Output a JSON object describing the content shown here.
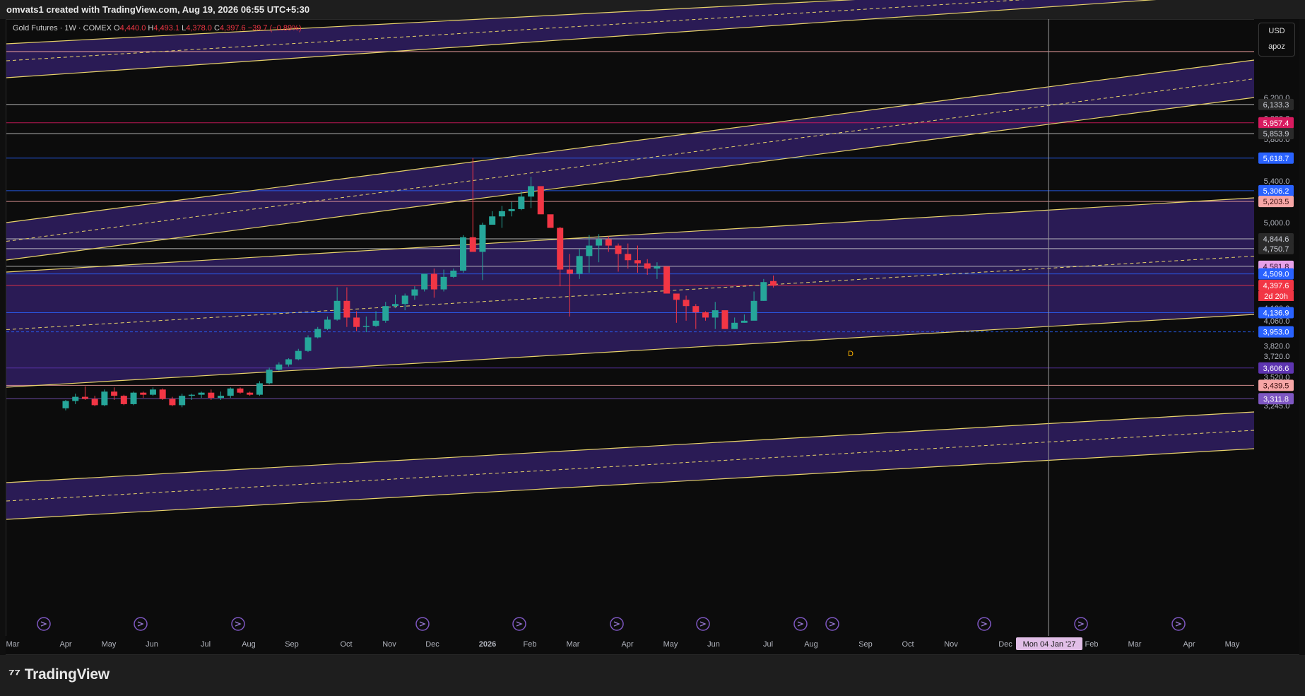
{
  "header": {
    "credit": "omvats1 created with TradingView.com, Aug 19, 2026 06:55 UTC+5:30"
  },
  "legend": {
    "symbol": "Gold Futures · 1W · COMEX",
    "o_label": "O",
    "o_value": "4,440.0",
    "h_label": "H",
    "h_value": "4,493.1",
    "l_label": "L",
    "l_value": "4,378.0",
    "c_label": "C",
    "c_value": "4,397.6",
    "change": "−39.7 (−0.89%)"
  },
  "currency": {
    "unit": "USD",
    "scale": "apoz"
  },
  "footer": {
    "brand": "TradingView"
  },
  "colors": {
    "background": "#0c0c0c",
    "channel_fill": "#2a1b55",
    "channel_line": "#e8d36b",
    "up_candle": "#26a69a",
    "down_candle": "#f23645",
    "crosshair": "#9a9a9a"
  },
  "price_axis_ticks": [
    "6,200.0",
    "6,000.0",
    "5,800.0",
    "5,400.0",
    "5,000.0",
    "4,840.0",
    "4,500.0",
    "4,300.0",
    "4,180.0",
    "4,060.0",
    "3,820.0",
    "3,720.0",
    "3,620.0",
    "3,520.0",
    "3,420.0",
    "3,320.0",
    "3,245.0"
  ],
  "price_levels": [
    {
      "value": "6,133.3",
      "bg": "#2a2a2a",
      "fg": "#d1d4dc",
      "line": "#cfcfcf"
    },
    {
      "value": "5,957.4",
      "bg": "#d81b60",
      "fg": "#ffffff",
      "line": "#d81b60"
    },
    {
      "value": "5,853.9",
      "bg": "#2a2a2a",
      "fg": "#d1d4dc",
      "line": "#cfcfcf"
    },
    {
      "value": "5,618.7",
      "bg": "#2962ff",
      "fg": "#ffffff",
      "line": "#2962ff"
    },
    {
      "value": "5,306.2",
      "bg": "#2962ff",
      "fg": "#ffffff",
      "line": "#2962ff"
    },
    {
      "value": "5,203.5",
      "bg": "#f7a6a6",
      "fg": "#3a0e0e",
      "line": "#f0a0a0"
    },
    {
      "value": "4,844.6",
      "bg": "#2a2a2a",
      "fg": "#d1d4dc",
      "line": "#cfcfcf"
    },
    {
      "value": "4,750.7",
      "bg": "#2a2a2a",
      "fg": "#d1d4dc",
      "line": "#cfcfcf"
    },
    {
      "value": "4,581.8",
      "bg": "#e6a0e8",
      "fg": "#2a0a2a",
      "line": "#cfcfcf"
    },
    {
      "value": "4,509.0",
      "bg": "#2962ff",
      "fg": "#ffffff",
      "line": "#2962ff"
    },
    {
      "value": "4,397.6",
      "bg": "#f23645",
      "fg": "#ffffff",
      "line": "#f23645"
    },
    {
      "value": "4,136.9",
      "bg": "#2962ff",
      "fg": "#ffffff",
      "line": "#2962ff"
    },
    {
      "value": "3,953.0",
      "bg": "#2962ff",
      "fg": "#ffffff",
      "line": "#2962ff"
    },
    {
      "value": "3,606.6",
      "bg": "#5e35b1",
      "fg": "#ffffff",
      "line": "#5e35b1"
    },
    {
      "value": "3,439.5",
      "bg": "#f7a6a6",
      "fg": "#3a0e0e",
      "line": "#f0a0a0"
    },
    {
      "value": "3,311.8",
      "bg": "#7e57c2",
      "fg": "#ffffff",
      "line": "#7e57c2"
    }
  ],
  "countdown": "2d 20h",
  "time_axis": {
    "labels": [
      "Mar",
      "Apr",
      "May",
      "Jun",
      "Jul",
      "Aug",
      "Sep",
      "Oct",
      "Nov",
      "Dec",
      "2026",
      "Feb",
      "Mar",
      "Apr",
      "May",
      "Jun",
      "Jul",
      "Aug",
      "Sep",
      "Oct",
      "Nov",
      "Dec",
      "Feb",
      "Mar",
      "Apr",
      "May"
    ],
    "crosshair_label": "Mon 04 Jan '27"
  },
  "drawing_marker": "D",
  "chart_data": {
    "type": "candlestick",
    "candles": [
      [
        3220,
        3300,
        3200,
        3290
      ],
      [
        3290,
        3360,
        3260,
        3330
      ],
      [
        3330,
        3430,
        3300,
        3310
      ],
      [
        3310,
        3340,
        3240,
        3250
      ],
      [
        3250,
        3400,
        3240,
        3380
      ],
      [
        3380,
        3420,
        3300,
        3340
      ],
      [
        3340,
        3350,
        3250,
        3260
      ],
      [
        3260,
        3380,
        3250,
        3370
      ],
      [
        3370,
        3380,
        3320,
        3350
      ],
      [
        3350,
        3420,
        3340,
        3400
      ],
      [
        3400,
        3410,
        3300,
        3310
      ],
      [
        3310,
        3330,
        3240,
        3250
      ],
      [
        3250,
        3360,
        3230,
        3340
      ],
      [
        3340,
        3360,
        3300,
        3350
      ],
      [
        3350,
        3380,
        3320,
        3370
      ],
      [
        3370,
        3400,
        3300,
        3320
      ],
      [
        3320,
        3380,
        3300,
        3340
      ],
      [
        3340,
        3420,
        3320,
        3410
      ],
      [
        3410,
        3420,
        3360,
        3370
      ],
      [
        3370,
        3380,
        3340,
        3350
      ],
      [
        3350,
        3480,
        3340,
        3460
      ],
      [
        3460,
        3610,
        3450,
        3590
      ],
      [
        3590,
        3660,
        3580,
        3640
      ],
      [
        3640,
        3700,
        3620,
        3690
      ],
      [
        3690,
        3790,
        3680,
        3770
      ],
      [
        3770,
        3920,
        3760,
        3900
      ],
      [
        3900,
        4000,
        3890,
        3980
      ],
      [
        3980,
        4100,
        3970,
        4070
      ],
      [
        4070,
        4380,
        4060,
        4250
      ],
      [
        4250,
        4380,
        4000,
        4090
      ],
      [
        4090,
        4150,
        3960,
        4000
      ],
      [
        4000,
        4100,
        3950,
        4010
      ],
      [
        4010,
        4150,
        4000,
        4060
      ],
      [
        4060,
        4240,
        4040,
        4200
      ],
      [
        4200,
        4310,
        4180,
        4220
      ],
      [
        4220,
        4320,
        4160,
        4300
      ],
      [
        4300,
        4390,
        4260,
        4360
      ],
      [
        4360,
        4480,
        4340,
        4510
      ],
      [
        4510,
        4560,
        4280,
        4360
      ],
      [
        4360,
        4550,
        4340,
        4480
      ],
      [
        4480,
        4560,
        4470,
        4540
      ],
      [
        4540,
        4880,
        4520,
        4860
      ],
      [
        4860,
        5620,
        4750,
        4720
      ],
      [
        4720,
        5000,
        4450,
        4980
      ],
      [
        4980,
        5110,
        4990,
        5060
      ],
      [
        5060,
        5160,
        4950,
        5110
      ],
      [
        5110,
        5200,
        5060,
        5130
      ],
      [
        5130,
        5300,
        5120,
        5250
      ],
      [
        5250,
        5440,
        5140,
        5350
      ],
      [
        5350,
        5300,
        5100,
        5080
      ],
      [
        5080,
        5050,
        4990,
        4950
      ],
      [
        4950,
        4960,
        4390,
        4550
      ],
      [
        4550,
        4700,
        4100,
        4510
      ],
      [
        4510,
        4750,
        4460,
        4680
      ],
      [
        4680,
        4880,
        4520,
        4780
      ],
      [
        4780,
        4890,
        4620,
        4840
      ],
      [
        4840,
        4870,
        4720,
        4780
      ],
      [
        4780,
        4800,
        4530,
        4700
      ],
      [
        4700,
        4800,
        4560,
        4640
      ],
      [
        4640,
        4780,
        4520,
        4610
      ],
      [
        4610,
        4650,
        4500,
        4560
      ],
      [
        4560,
        4620,
        4460,
        4580
      ],
      [
        4580,
        4560,
        4420,
        4320
      ],
      [
        4320,
        4270,
        4040,
        4260
      ],
      [
        4260,
        4300,
        4060,
        4200
      ],
      [
        4200,
        4220,
        3980,
        4140
      ],
      [
        4140,
        4150,
        4060,
        4090
      ],
      [
        4090,
        4240,
        3980,
        4160
      ],
      [
        4160,
        4100,
        4020,
        3980
      ],
      [
        3980,
        4090,
        3980,
        4040
      ],
      [
        4040,
        4120,
        4040,
        4060
      ],
      [
        4060,
        4340,
        4070,
        4250
      ],
      [
        4250,
        4460,
        4250,
        4430
      ],
      [
        4440,
        4493.1,
        4378,
        4397.6
      ]
    ]
  }
}
